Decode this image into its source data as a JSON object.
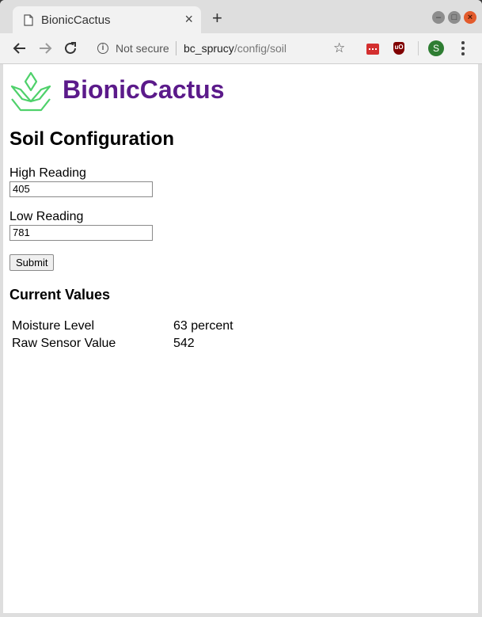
{
  "browser": {
    "tab_title": "BionicCactus",
    "new_tab_glyph": "+",
    "close_glyph": "×",
    "security_label": "Not secure",
    "url_host": "bc_sprucy",
    "url_path": "/config/soil",
    "profile_initial": "S",
    "ublock_label": "uO"
  },
  "site": {
    "brand": "BionicCactus",
    "brand_color": "#5b1a8a",
    "logo_color": "#4fd16b"
  },
  "form": {
    "title": "Soil Configuration",
    "high_label": "High Reading",
    "high_value": "405",
    "low_label": "Low Reading",
    "low_value": "781",
    "submit_label": "Submit"
  },
  "current": {
    "title": "Current Values",
    "rows": [
      {
        "label": "Moisture Level",
        "value": "63 percent"
      },
      {
        "label": "Raw Sensor Value",
        "value": "542"
      }
    ]
  }
}
